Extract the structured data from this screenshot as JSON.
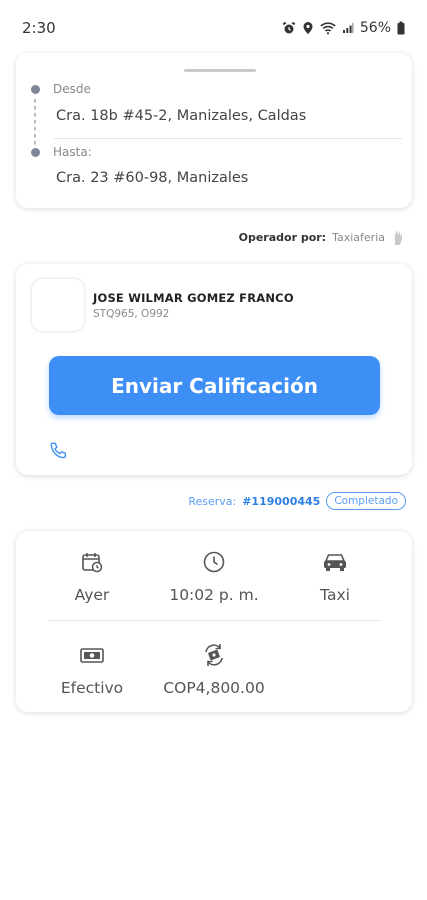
{
  "status_bar": {
    "time": "2:30",
    "battery": "56%"
  },
  "route": {
    "from_label": "Desde",
    "from_address": "Cra. 18b #45-2, Manizales, Caldas",
    "to_label": "Hasta:",
    "to_address": "Cra. 23 #60-98, Manizales"
  },
  "operator": {
    "label": "Operador por:",
    "name": "Taxiaferia"
  },
  "driver": {
    "name": "JOSE WILMAR GOMEZ FRANCO",
    "plate": "STQ965, O992",
    "rate_button_label": "Enviar Calificación"
  },
  "reservation": {
    "label": "Reserva:",
    "number": "#119000445",
    "status": "Completado"
  },
  "trip_info": {
    "date": "Ayer",
    "time": "10:02 p. m.",
    "vehicle": "Taxi",
    "payment_method": "Efectivo",
    "amount": "COP4,800.00"
  },
  "colors": {
    "accent": "#3d8ff5",
    "text": "#444444",
    "muted": "#888888"
  },
  "icons": [
    "alarm-icon",
    "location-icon",
    "wifi-icon",
    "signal-icon",
    "battery-icon",
    "operator-logo-icon",
    "phone-icon",
    "calendar-icon",
    "clock-icon",
    "car-icon",
    "cash-icon",
    "money-exchange-icon"
  ]
}
